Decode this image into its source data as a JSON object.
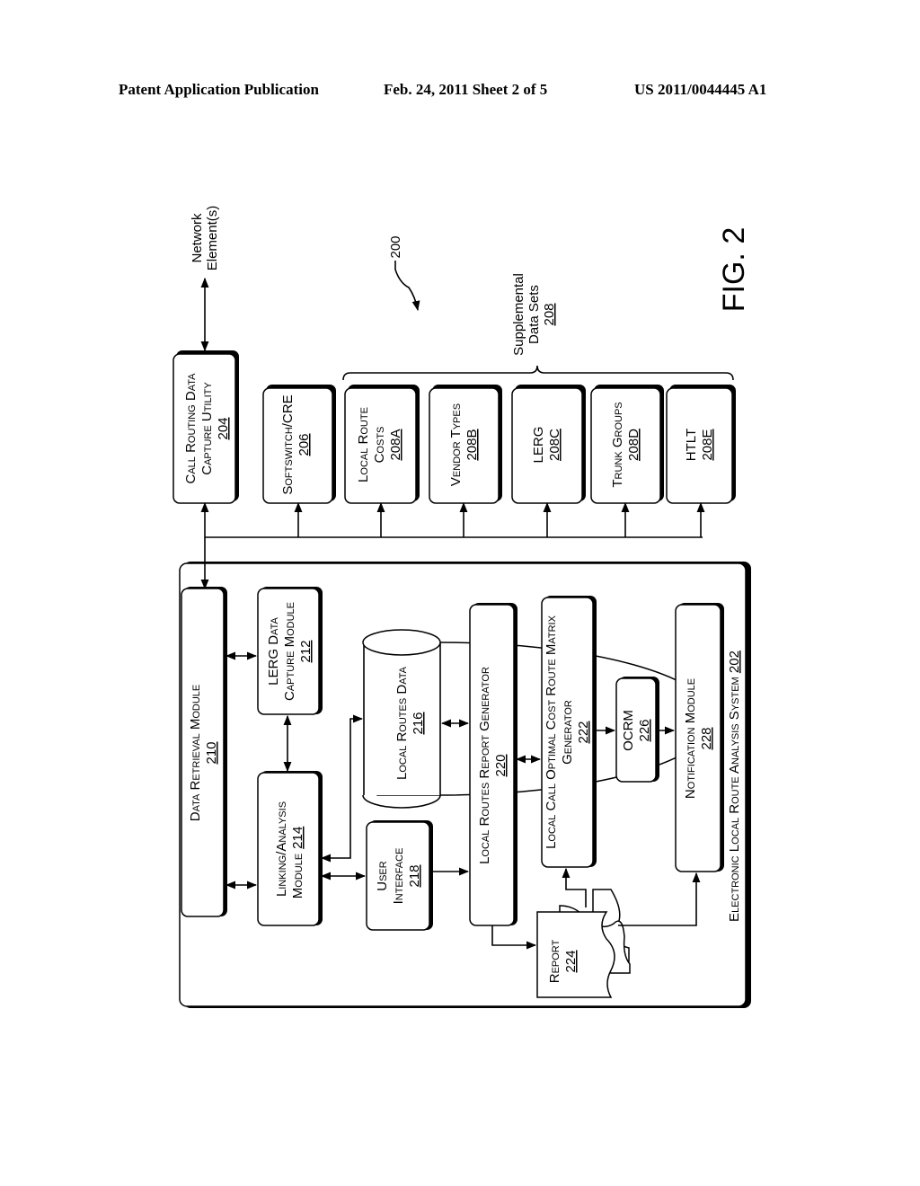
{
  "header": {
    "publication": "Patent Application Publication",
    "date_sheet": "Feb. 24, 2011   Sheet 2 of 5",
    "patent_number": "US 2011/0044445 A1"
  },
  "figure": {
    "label": "FIG. 2",
    "ref": "200",
    "network_elements": [
      "Network",
      "Element(s)"
    ],
    "call_routing": {
      "lines": [
        "Call Routing Data",
        "Capture Utility"
      ],
      "ref": "204"
    },
    "softswitch": {
      "lines": [
        "Softswitch/CRE"
      ],
      "ref": "206"
    },
    "supplemental": {
      "lines": [
        "Supplemental",
        "Data Sets"
      ],
      "ref": "208"
    },
    "datasets": [
      {
        "lines": [
          "Local Route",
          "Costs"
        ],
        "ref": "208A"
      },
      {
        "lines": [
          "Vendor Types"
        ],
        "ref": "208B"
      },
      {
        "lines": [
          "LERG"
        ],
        "ref": "208C"
      },
      {
        "lines": [
          "Trunk Groups"
        ],
        "ref": "208D"
      },
      {
        "lines": [
          "HTLT"
        ],
        "ref": "208E"
      }
    ],
    "system": {
      "label": "Electronic Local Route Analysis  System",
      "ref": "202"
    },
    "data_retrieval": {
      "lines": [
        "Data Retrieval Module"
      ],
      "ref": "210"
    },
    "lerg_capture": {
      "lines": [
        "LERG Data",
        "Capture Module"
      ],
      "ref": "212"
    },
    "linking": {
      "lines": [
        "Linking/Analysis",
        "Module"
      ],
      "ref": "214"
    },
    "local_routes_data": {
      "lines": [
        "Local Routes Data"
      ],
      "ref": "216"
    },
    "user_interface": {
      "lines": [
        "User",
        "Interface"
      ],
      "ref": "218"
    },
    "report_generator": {
      "lines": [
        "Local Routes Report Generator"
      ],
      "ref": "220"
    },
    "matrix_generator": {
      "lines": [
        "Local Call Optimal Cost Route Matrix",
        "Generator"
      ],
      "ref": "222"
    },
    "report": {
      "lines": [
        "Report"
      ],
      "ref": "224"
    },
    "ocrm": {
      "lines": [
        "OCRM"
      ],
      "ref": "226"
    },
    "notification": {
      "lines": [
        "Notification Module"
      ],
      "ref": "228"
    }
  }
}
